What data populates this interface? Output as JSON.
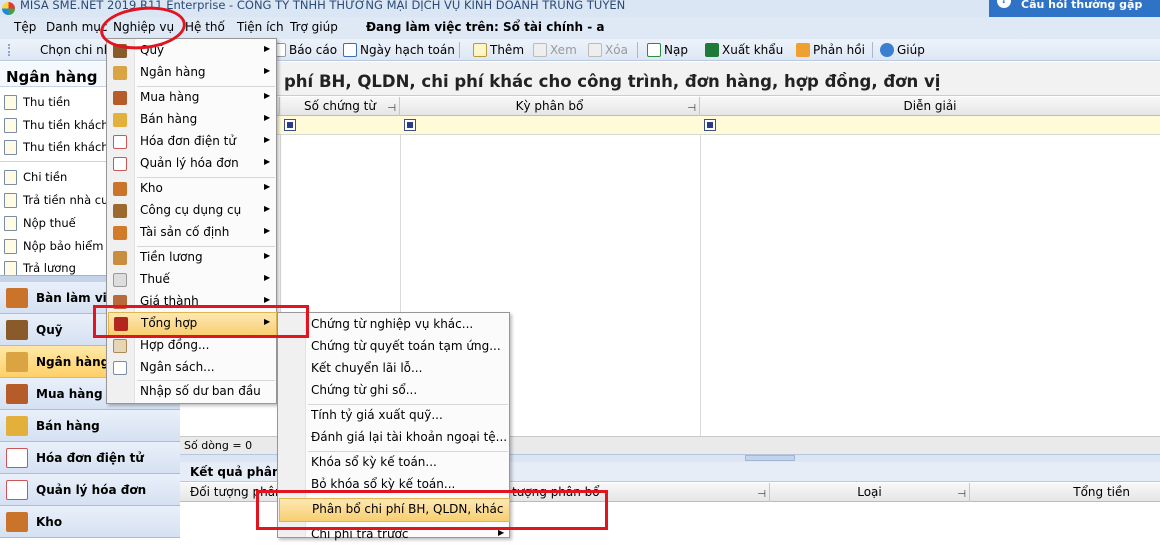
{
  "window": {
    "title": "MISA SME.NET 2019 R11 Enterprise - CÔNG TY TNHH THƯƠNG MẠI DỊCH VỤ KINH DOANH TRUNG TUYẾN",
    "faq_label": "Câu hỏi thường gặp"
  },
  "menubar": {
    "items": [
      "Tệp",
      "Danh mục",
      "Nghiệp vụ",
      "Hệ thống",
      "Tiện ích",
      "Trợ giúp"
    ],
    "context_label": "Đang làm việc trên: Sổ tài chính - a"
  },
  "toolbar": {
    "choose": "Chọn chi nh",
    "report": "Báo cáo",
    "date": "Ngày hạch toán",
    "add": "Thêm",
    "view": "Xem",
    "delete": "Xóa",
    "load": "Nạp",
    "export": "Xuất khẩu",
    "feedback": "Phản hồi",
    "help": "Giúp"
  },
  "left_panel": {
    "header": "Ngân hàng",
    "items": [
      "Thu tiền",
      "Thu tiền khách h",
      "Thu tiền khách",
      "Chi tiền",
      "Trả tiền nhà cun",
      "Nộp thuế",
      "Nộp bảo hiểm",
      "Trả lương"
    ],
    "nav": [
      "Bàn làm việc",
      "Quỹ",
      "Ngân hàng",
      "Mua hàng",
      "Bán hàng",
      "Hóa đơn điện tử",
      "Quản lý hóa đơn",
      "Kho"
    ]
  },
  "main": {
    "title": "phí BH, QLDN, chi phí khác cho công trình, đơn hàng, hợp đồng, đơn vị",
    "columns": [
      "Số chứng từ",
      "Kỳ phân bổ",
      "Diễn giải"
    ],
    "row_count": "Số dòng = 0",
    "result_title": "Kết quả phân bổ",
    "result_columns": [
      "Đối tượng phân bổ",
      "tượng phân bổ",
      "Loại",
      "Tổng tiền"
    ]
  },
  "menu_main": {
    "items": [
      "Quỹ",
      "Ngân hàng",
      "Mua hàng",
      "Bán hàng",
      "Hóa đơn điện tử",
      "Quản lý hóa đơn",
      "Kho",
      "Công cụ dụng cụ",
      "Tài sản cố định",
      "Tiền lương",
      "Thuế",
      "Giá thành",
      "Tổng hợp",
      "Hợp đồng...",
      "Ngân sách...",
      "Nhập số dư ban đầu"
    ]
  },
  "menu_sub": {
    "items": [
      "Chứng từ nghiệp vụ khác...",
      "Chứng từ quyết toán tạm ứng...",
      "Kết chuyển lãi lỗ...",
      "Chứng từ ghi sổ...",
      "Tính tỷ giá xuất quỹ...",
      "Đánh giá lại tài khoản ngoại tệ...",
      "Khóa sổ kỳ kế toán...",
      "Bỏ khóa sổ kỳ kế toán...",
      "Phân bổ chi phí BH, QLDN, khác",
      "Chi phí trả trước"
    ]
  },
  "colors": {
    "highlight": "#f8cf71",
    "annotation_red": "#e1141f",
    "active_nav": "#ffd068"
  }
}
